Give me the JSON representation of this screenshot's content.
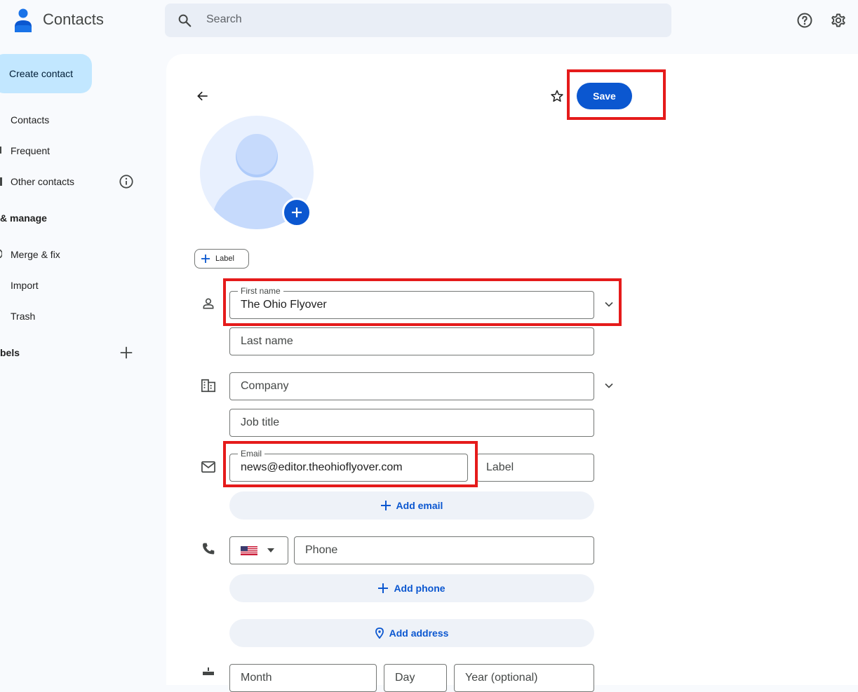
{
  "app": {
    "title": "Contacts"
  },
  "search": {
    "placeholder": "Search"
  },
  "sidebar": {
    "create_label": "Create contact",
    "items": [
      {
        "label": "Contacts"
      },
      {
        "label": "Frequent"
      },
      {
        "label": "Other contacts"
      }
    ],
    "section_manage": "& manage",
    "manage_items": [
      {
        "label": "Merge & fix"
      },
      {
        "label": "Import"
      },
      {
        "label": "Trash"
      }
    ],
    "section_labels": "bels"
  },
  "toolbar": {
    "save_label": "Save"
  },
  "form": {
    "label_chip": "Label",
    "first_name": {
      "legend": "First name",
      "value": "The Ohio Flyover"
    },
    "last_name": {
      "placeholder": "Last name"
    },
    "company": {
      "placeholder": "Company"
    },
    "job_title": {
      "placeholder": "Job title"
    },
    "email": {
      "legend": "Email",
      "value": "news@editor.theohioflyover.com"
    },
    "email_label": {
      "placeholder": "Label"
    },
    "add_email": "Add email",
    "phone": {
      "placeholder": "Phone"
    },
    "add_phone": "Add phone",
    "add_address": "Add address",
    "birthday": {
      "month": "Month",
      "day": "Day",
      "year": "Year (optional)"
    }
  },
  "colors": {
    "accent": "#0b57d0",
    "highlight": "#e51b1b",
    "create_bg": "#c2e7ff"
  }
}
